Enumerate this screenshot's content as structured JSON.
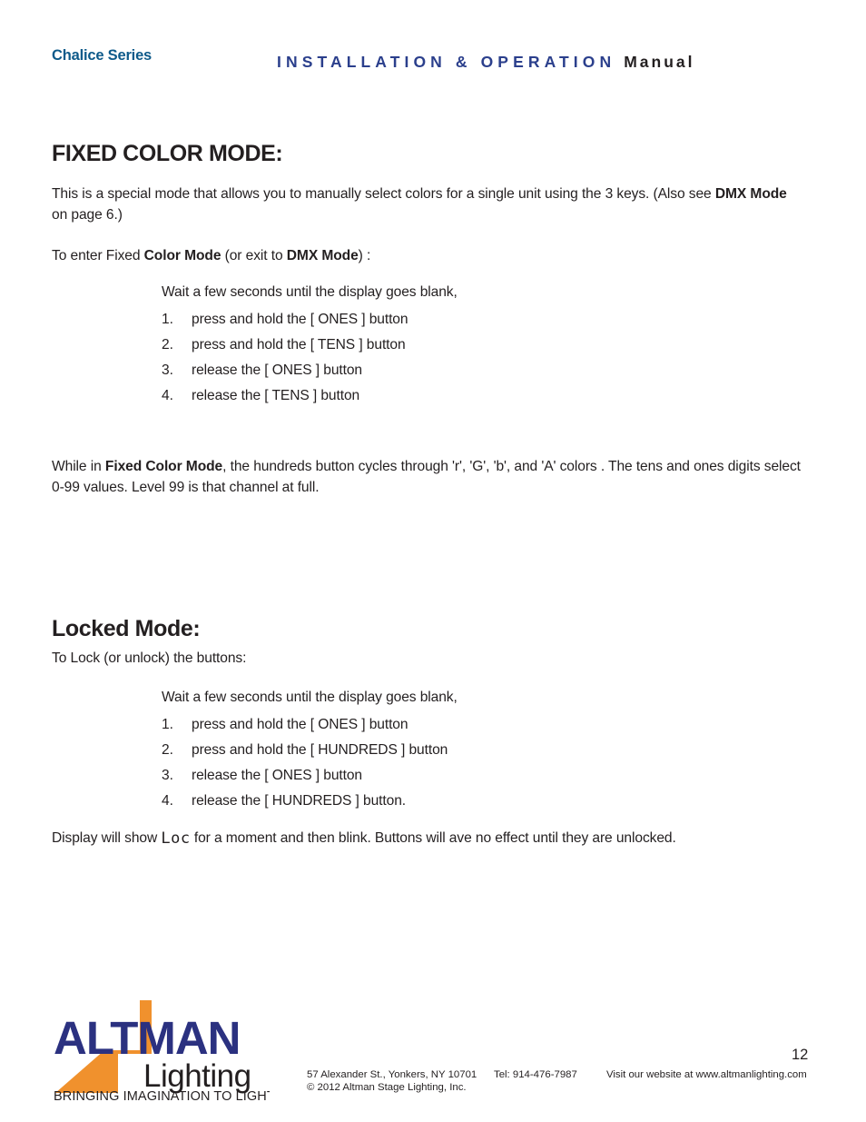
{
  "header": {
    "series": "Chalice Series",
    "title_main": "INSTALLATION & OPERATION",
    "title_manual": "Manual",
    "series_color": "#0e5a8a",
    "title_color": "#2b3f8c"
  },
  "fixed_color_mode": {
    "heading": "FIXED COLOR MODE:",
    "intro_part1": "This is a special mode that allows you to manually select colors for a single unit using the 3 keys. (Also see ",
    "intro_bold": "DMX Mode",
    "intro_part2": " on page 6.)",
    "enter_part1": "To enter Fixed ",
    "enter_bold1": "Color Mode",
    "enter_part2": " (or exit to ",
    "enter_bold2": "DMX Mode",
    "enter_part3": ") :",
    "steps_lead": "Wait a few seconds until the display goes blank,",
    "steps": [
      {
        "num": "1.",
        "text": "press and hold the [ ONES ] button"
      },
      {
        "num": "2.",
        "text": "press and hold the [ TENS ] button"
      },
      {
        "num": "3.",
        "text": "release the [ ONES ] button"
      },
      {
        "num": "4.",
        "text": "release the [ TENS ] button"
      }
    ],
    "while_part1": "While in ",
    "while_bold": "Fixed Color Mode",
    "while_part2": ", the hundreds button cycles through 'r', 'G', 'b', and 'A' colors . The tens and ones digits select 0-99 values.  Level 99 is that channel at full."
  },
  "locked_mode": {
    "heading": "Locked Mode:",
    "intro": "To Lock (or unlock) the buttons:",
    "steps_lead": "Wait a few seconds until the display goes blank,",
    "steps": [
      {
        "num": "1.",
        "text": "press and hold the [ ONES ] button"
      },
      {
        "num": "2.",
        "text": "press and hold the [ HUNDREDS ] button"
      },
      {
        "num": "3.",
        "text": "release the [ ONES ] button"
      },
      {
        "num": "4.",
        "text": "release the [ HUNDREDS ] button."
      }
    ],
    "display_part1": "Display will show ",
    "display_glyph": "Loc",
    "display_part2": " for a moment and then blink.  Buttons will ave no effect until they are unlocked."
  },
  "footer": {
    "logo": {
      "brand": "ALTMAN",
      "sub": "Lighting",
      "tagline": "BRINGING IMAGINATION TO LIGHT",
      "navy": "#2b3180",
      "orange": "#f0912d"
    },
    "address": "57 Alexander St., Yonkers, NY 10701",
    "tel": "Tel: 914-476-7987",
    "website": "Visit our website at www.altmanlighting.com",
    "copyright": "© 2012 Altman Stage Lighting, Inc.",
    "page_number": "12"
  }
}
